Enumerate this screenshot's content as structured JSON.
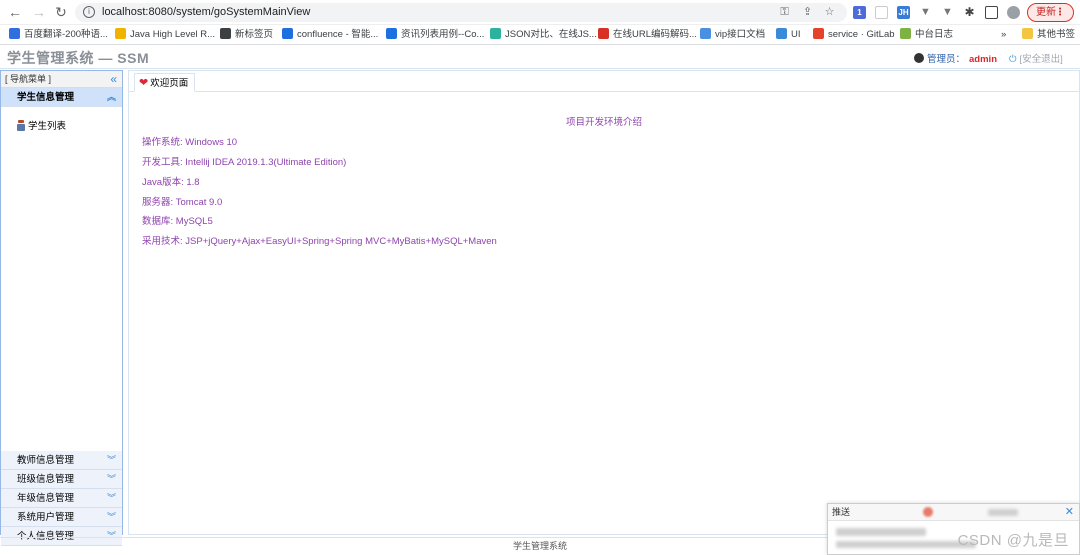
{
  "browser": {
    "url": "localhost:8080/system/goSystemMainView",
    "update_label": "更新",
    "bookmarks": [
      {
        "label": "百度翻译-200种语...",
        "color": "#2f6fe0"
      },
      {
        "label": "Java High Level R...",
        "color": "#f0b400"
      },
      {
        "label": "新标签页",
        "color": "#3c4043"
      },
      {
        "label": "confluence - 智能...",
        "color": "#1e6fe0"
      },
      {
        "label": "资讯列表用例--Co...",
        "color": "#1e6fe0"
      },
      {
        "label": "JSON对比、在线JS...",
        "color": "#2bb3a0"
      },
      {
        "label": "在线URL编码解码...",
        "color": "#d93025"
      },
      {
        "label": "vip接口文档",
        "color": "#4a90e2"
      },
      {
        "label": "UI",
        "color": "#3b8ad9"
      },
      {
        "label": "service · GitLab",
        "color": "#e2432a"
      },
      {
        "label": "中台日志",
        "color": "#7cb342"
      }
    ],
    "overflow_label": "»",
    "other_bookmarks": "其他书签"
  },
  "header": {
    "title": "学生管理系统 — SSM",
    "admin_label": "管理员：",
    "admin_name": "admin",
    "logout_label": "[安全退出]"
  },
  "sidebar": {
    "title": "[ 导航菜单 ]",
    "active_section": "学生信息管理",
    "active_items": [
      "学生列表"
    ],
    "sections": [
      "教师信息管理",
      "班级信息管理",
      "年级信息管理",
      "系统用户管理",
      "个人信息管理"
    ]
  },
  "main": {
    "tab_label": "欢迎页面",
    "env_title": "项目开发环境介绍",
    "env_lines": [
      "操作系统: Windows 10",
      "开发工具: Intellij IDEA 2019.1.3(Ultimate Edition)",
      "Java版本: 1.8",
      "服务器: Tomcat 9.0",
      "数据库: MySQL5",
      "采用技术: JSP+jQuery+Ajax+EasyUI+Spring+Spring MVC+MyBatis+MySQL+Maven"
    ]
  },
  "footer": {
    "text": "学生管理系统"
  },
  "popup": {
    "title": "推送",
    "watermark": "CSDN @九是旦"
  }
}
